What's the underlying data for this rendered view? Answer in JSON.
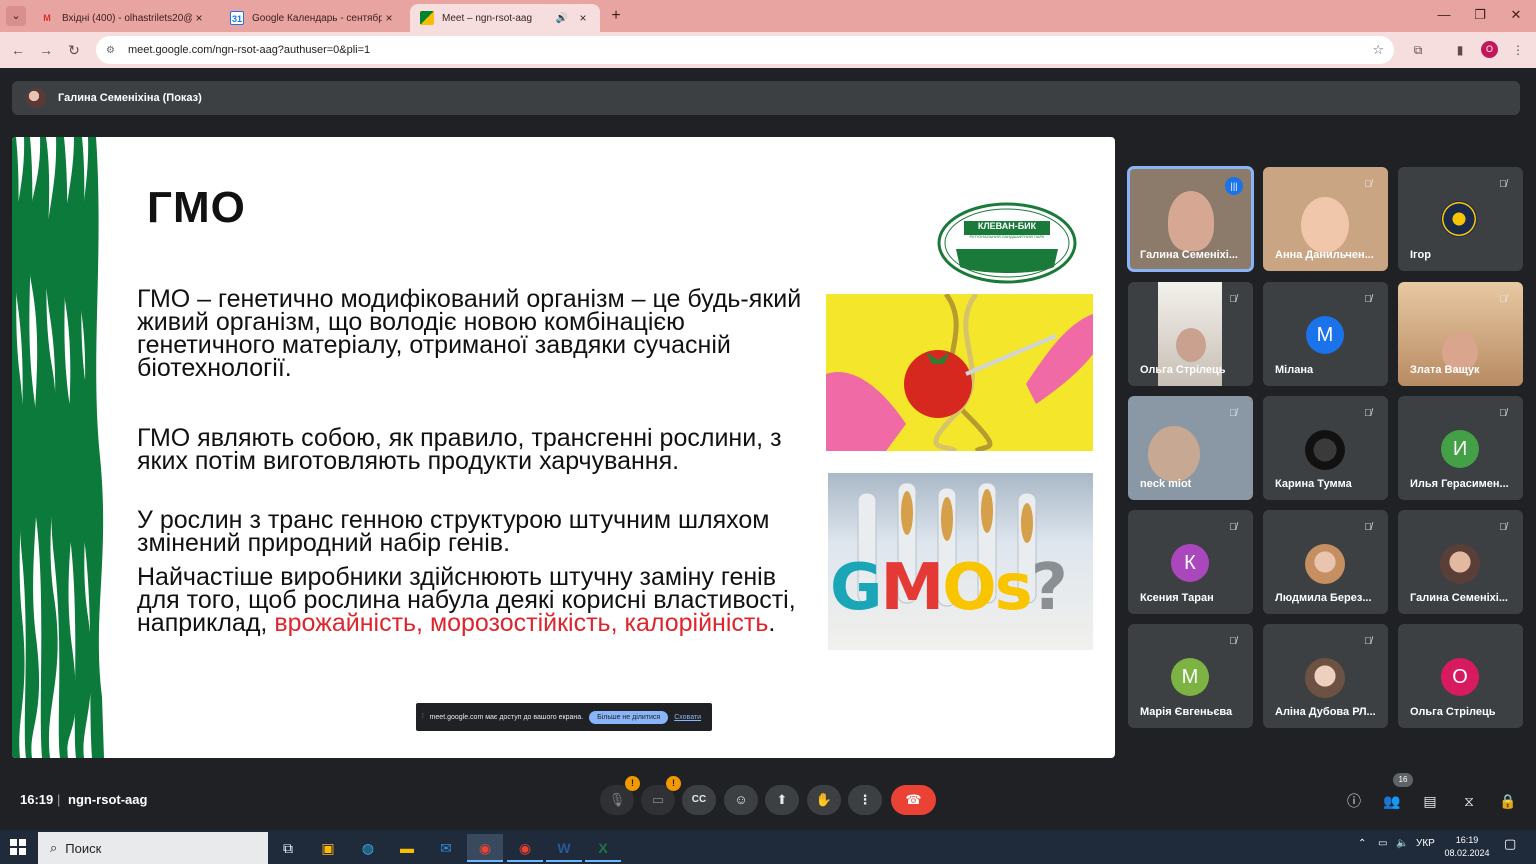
{
  "browser": {
    "tabs": [
      {
        "title": "Вхідні (400) - olhastrilets20@g",
        "icon": "gmail-icon",
        "active": false
      },
      {
        "title": "Google Календарь - сентябрь",
        "icon": "calendar-icon",
        "active": false
      },
      {
        "title": "Meet – ngn-rsot-aag",
        "icon": "meet-icon",
        "active": true
      }
    ],
    "url": "meet.google.com/ngn-rsot-aag?authuser=0&pli=1",
    "profile_initial": "O",
    "accent_color": "#e8a4a0"
  },
  "meet": {
    "presenter_label": "Галина Семеніхіна (Показ)",
    "time": "16:19",
    "separator": "|",
    "meeting_code": "ngn-rsot-aag",
    "people_count": "16",
    "participants": [
      {
        "name": "Галина Семеніхі...",
        "speaking": true,
        "type": "video"
      },
      {
        "name": "Анна Данильчен...",
        "muted": true,
        "type": "video"
      },
      {
        "name": "Ігор",
        "muted": true,
        "type": "logo"
      },
      {
        "name": "Ольга Стрілець",
        "muted": true,
        "type": "video"
      },
      {
        "name": "Мілана",
        "muted": true,
        "initial": "М",
        "color": "#1a73e8"
      },
      {
        "name": "Злата Ващук",
        "muted": true,
        "type": "video"
      },
      {
        "name": "neck miot",
        "muted": true,
        "type": "video"
      },
      {
        "name": "Карина Тумма",
        "muted": true,
        "type": "photo"
      },
      {
        "name": "Илья Герасимен...",
        "muted": true,
        "initial": "И",
        "color": "#43a047"
      },
      {
        "name": "Ксения Таран",
        "muted": true,
        "initial": "К",
        "color": "#ab47bc"
      },
      {
        "name": "Людмила Берез...",
        "muted": true,
        "type": "photo"
      },
      {
        "name": "Галина Семеніхі...",
        "muted": true,
        "type": "photo"
      },
      {
        "name": "Марія Євгеньєва",
        "muted": true,
        "initial": "М",
        "color": "#7cb342"
      },
      {
        "name": "Аліна Дубова РЛ...",
        "muted": true,
        "type": "photo"
      },
      {
        "name": "Ольга Стрілець",
        "muted": false,
        "initial": "О",
        "color": "#d81b60"
      }
    ]
  },
  "slide": {
    "title": "ГМО",
    "p1": "ГМО – генетично модифікований організм – це будь-який живий організм, що володіє новою комбінацією генетичного матеріалу, отриманої завдяки сучасній біотехнології.",
    "p2": "ГМО являють собою, як правило, трансгенні рослини, з яких потім виготовляють продукти харчування.",
    "p3": "У рослин з транс генною структурою штучним шляхом змінений природний набір генів.",
    "p4": "Найчастіше виробники здійснюють штучну заміну генів для того, щоб рослина набула деякі корисні властивості, наприклад,",
    "p4_red": "врожайність, морозостійкість, калорійність",
    "p4_end": ".",
    "logo_text": "КЛЕВАН-БИК",
    "logo_subtext": "РЕГІОНАЛЬНИЙ ЛАНДШАФТНИЙ ПАРК",
    "gmo_image_text": "GMOs?"
  },
  "share_notice": {
    "text": "meet.google.com має доступ до вашого екрана.",
    "stop_label": "Більше не ділитися",
    "hide_label": "Сховати"
  },
  "taskbar": {
    "search_placeholder": "Поиск",
    "language": "УКР",
    "time": "16:19",
    "date": "08.02.2024"
  }
}
